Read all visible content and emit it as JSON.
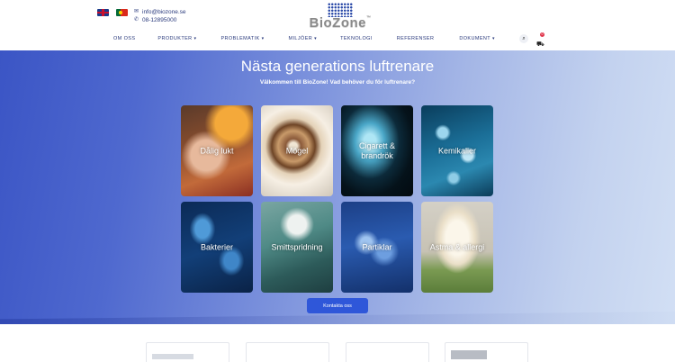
{
  "header": {
    "flags": [
      "uk-flag",
      "portugal-flag"
    ],
    "email": "info@biozone.se",
    "phone": "08-12895000",
    "logo_text": "BioZone",
    "logo_mark": "™",
    "nav": [
      {
        "label": "OM OSS",
        "dropdown": false
      },
      {
        "label": "PRODUKTER",
        "dropdown": true
      },
      {
        "label": "PROBLEMATIK",
        "dropdown": true
      },
      {
        "label": "MILJÖER",
        "dropdown": true
      },
      {
        "label": "TEKNOLOGI",
        "dropdown": false
      },
      {
        "label": "REFERENSER",
        "dropdown": false
      },
      {
        "label": "DOKUMENT",
        "dropdown": true
      }
    ],
    "cart_count": "0"
  },
  "hero": {
    "title": "Nästa generations luftrenare",
    "subtitle": "Välkommen till BioZone! Vad behöver du för luftrenare?",
    "tiles": [
      {
        "label": "Dålig lukt"
      },
      {
        "label": "Mögel"
      },
      {
        "label": "Cigarett & brandrök"
      },
      {
        "label": "Kemikalier"
      },
      {
        "label": "Bakterier"
      },
      {
        "label": "Smittspridning"
      },
      {
        "label": "Partiklar"
      },
      {
        "label": "Astma & allergi"
      }
    ],
    "cta_label": "Kontakta oss"
  },
  "colors": {
    "accent": "#2f57d9",
    "nav_text": "#2a3a7c",
    "badge": "#e0344a"
  }
}
